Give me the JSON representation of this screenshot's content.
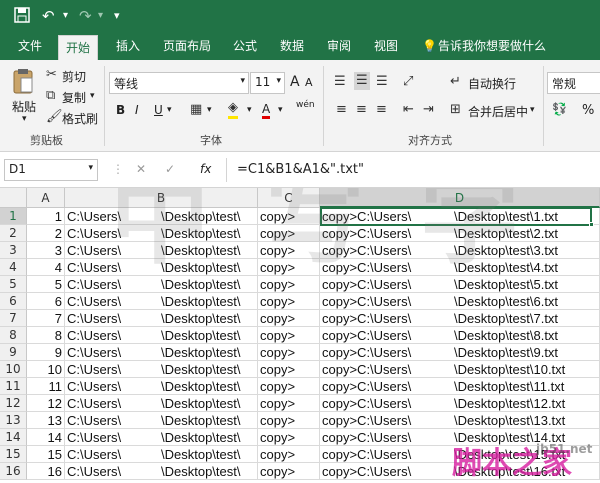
{
  "qat": {
    "save_icon": "save-icon",
    "undo": "↶",
    "redo": "↷",
    "customize": "▾"
  },
  "tabs": [
    "文件",
    "开始",
    "插入",
    "页面布局",
    "公式",
    "数据",
    "审阅",
    "视图"
  ],
  "tell_me": "告诉我你想要做什么",
  "clipboard": {
    "paste": "粘贴",
    "cut": "剪切",
    "copy": "复制",
    "format_painter": "格式刷",
    "title": "剪贴板"
  },
  "font": {
    "name": "等线",
    "size": "11",
    "title": "字体",
    "bold": "B",
    "italic": "I",
    "underline": "U",
    "grow": "A",
    "shrink": "A",
    "wen": "wén"
  },
  "alignment": {
    "wrap": "自动换行",
    "merge": "合并后居中",
    "title": "对齐方式"
  },
  "number": {
    "format": "常规",
    "percent": "%"
  },
  "formula_bar": {
    "name_box": "D1",
    "fx": "fx",
    "formula": "=C1&B1&A1&\".txt\""
  },
  "columns": [
    "A",
    "B",
    "C",
    "D"
  ],
  "rows": [
    {
      "n": "1",
      "a": "1",
      "b": "C:\\Users\\",
      "b2": "\\Desktop\\test\\",
      "c": "copy>",
      "d": "copy>C:\\Users\\",
      "d2": "\\Desktop\\test\\1.txt"
    },
    {
      "n": "2",
      "a": "2",
      "b": "C:\\Users\\",
      "b2": "\\Desktop\\test\\",
      "c": "copy>",
      "d": "copy>C:\\Users\\",
      "d2": "\\Desktop\\test\\2.txt"
    },
    {
      "n": "3",
      "a": "3",
      "b": "C:\\Users\\",
      "b2": "\\Desktop\\test\\",
      "c": "copy>",
      "d": "copy>C:\\Users\\",
      "d2": "\\Desktop\\test\\3.txt"
    },
    {
      "n": "4",
      "a": "4",
      "b": "C:\\Users\\",
      "b2": "\\Desktop\\test\\",
      "c": "copy>",
      "d": "copy>C:\\Users\\",
      "d2": "\\Desktop\\test\\4.txt"
    },
    {
      "n": "5",
      "a": "5",
      "b": "C:\\Users\\",
      "b2": "\\Desktop\\test\\",
      "c": "copy>",
      "d": "copy>C:\\Users\\",
      "d2": "\\Desktop\\test\\5.txt"
    },
    {
      "n": "6",
      "a": "6",
      "b": "C:\\Users\\",
      "b2": "\\Desktop\\test\\",
      "c": "copy>",
      "d": "copy>C:\\Users\\",
      "d2": "\\Desktop\\test\\6.txt"
    },
    {
      "n": "7",
      "a": "7",
      "b": "C:\\Users\\",
      "b2": "\\Desktop\\test\\",
      "c": "copy>",
      "d": "copy>C:\\Users\\",
      "d2": "\\Desktop\\test\\7.txt"
    },
    {
      "n": "8",
      "a": "8",
      "b": "C:\\Users\\",
      "b2": "\\Desktop\\test\\",
      "c": "copy>",
      "d": "copy>C:\\Users\\",
      "d2": "\\Desktop\\test\\8.txt"
    },
    {
      "n": "9",
      "a": "9",
      "b": "C:\\Users\\",
      "b2": "\\Desktop\\test\\",
      "c": "copy>",
      "d": "copy>C:\\Users\\",
      "d2": "\\Desktop\\test\\9.txt"
    },
    {
      "n": "10",
      "a": "10",
      "b": "C:\\Users\\",
      "b2": "\\Desktop\\test\\",
      "c": "copy>",
      "d": "copy>C:\\Users\\",
      "d2": "\\Desktop\\test\\10.txt"
    },
    {
      "n": "11",
      "a": "11",
      "b": "C:\\Users\\",
      "b2": "\\Desktop\\test\\",
      "c": "copy>",
      "d": "copy>C:\\Users\\",
      "d2": "\\Desktop\\test\\11.txt"
    },
    {
      "n": "12",
      "a": "12",
      "b": "C:\\Users\\",
      "b2": "\\Desktop\\test\\",
      "c": "copy>",
      "d": "copy>C:\\Users\\",
      "d2": "\\Desktop\\test\\12.txt"
    },
    {
      "n": "13",
      "a": "13",
      "b": "C:\\Users\\",
      "b2": "\\Desktop\\test\\",
      "c": "copy>",
      "d": "copy>C:\\Users\\",
      "d2": "\\Desktop\\test\\13.txt"
    },
    {
      "n": "14",
      "a": "14",
      "b": "C:\\Users\\",
      "b2": "\\Desktop\\test\\",
      "c": "copy>",
      "d": "copy>C:\\Users\\",
      "d2": "\\Desktop\\test\\14.txt"
    },
    {
      "n": "15",
      "a": "15",
      "b": "C:\\Users\\",
      "b2": "\\Desktop\\test\\",
      "c": "copy>",
      "d": "copy>C:\\Users\\",
      "d2": "\\Desktop\\test\\15.txt"
    },
    {
      "n": "16",
      "a": "16",
      "b": "C:\\Users\\",
      "b2": "\\Desktop\\test\\",
      "c": "copy>",
      "d": "copy>C:\\Users\\",
      "d2": "\\Desktop\\test\\16.txt"
    }
  ],
  "watermark": {
    "text": "脚本之家",
    "site": "jb51.net"
  },
  "colors": {
    "accent": "#217346",
    "selection": "#217346"
  }
}
